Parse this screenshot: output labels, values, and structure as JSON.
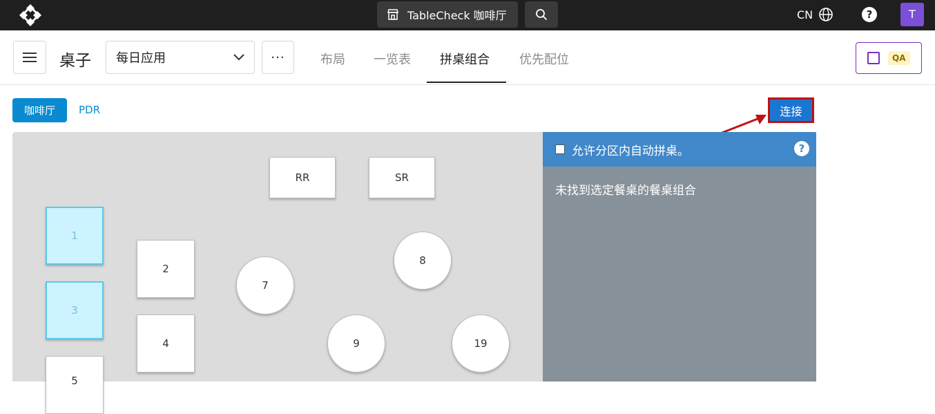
{
  "topbar": {
    "venue_label": "TableCheck 咖啡厅",
    "lang_label": "CN",
    "help_label": "?",
    "avatar_initial": "T"
  },
  "header": {
    "page_title": "桌子",
    "select_value": "每日应用",
    "more_label": "···",
    "tabs": [
      {
        "label": "布局",
        "active": false
      },
      {
        "label": "一览表",
        "active": false
      },
      {
        "label": "拼桌组合",
        "active": true
      },
      {
        "label": "优先配位",
        "active": false
      }
    ],
    "qa_badge": "QA"
  },
  "areas": {
    "active": "咖啡厅",
    "other": "PDR"
  },
  "connect_label": "连接",
  "tables": [
    {
      "label": "RR",
      "shape": "rect",
      "selected": false
    },
    {
      "label": "SR",
      "shape": "rect",
      "selected": false
    },
    {
      "label": "1",
      "shape": "rect",
      "selected": true
    },
    {
      "label": "3",
      "shape": "rect",
      "selected": true
    },
    {
      "label": "5",
      "shape": "rect",
      "selected": false
    },
    {
      "label": "2",
      "shape": "rect",
      "selected": false
    },
    {
      "label": "4",
      "shape": "rect",
      "selected": false
    },
    {
      "label": "7",
      "shape": "round",
      "selected": false
    },
    {
      "label": "8",
      "shape": "round",
      "selected": false
    },
    {
      "label": "9",
      "shape": "round",
      "selected": false
    },
    {
      "label": "19",
      "shape": "round",
      "selected": false
    }
  ],
  "panel": {
    "checkbox_label": "允许分区内自动拼桌。",
    "help_label": "?",
    "message": "未找到选定餐桌的餐桌组合"
  },
  "colors": {
    "accent": "#0a8ad0",
    "panel_header": "#4088c9",
    "panel_body": "#879199",
    "qa_border": "#7b2cbf",
    "annotation_red": "#c21111"
  }
}
